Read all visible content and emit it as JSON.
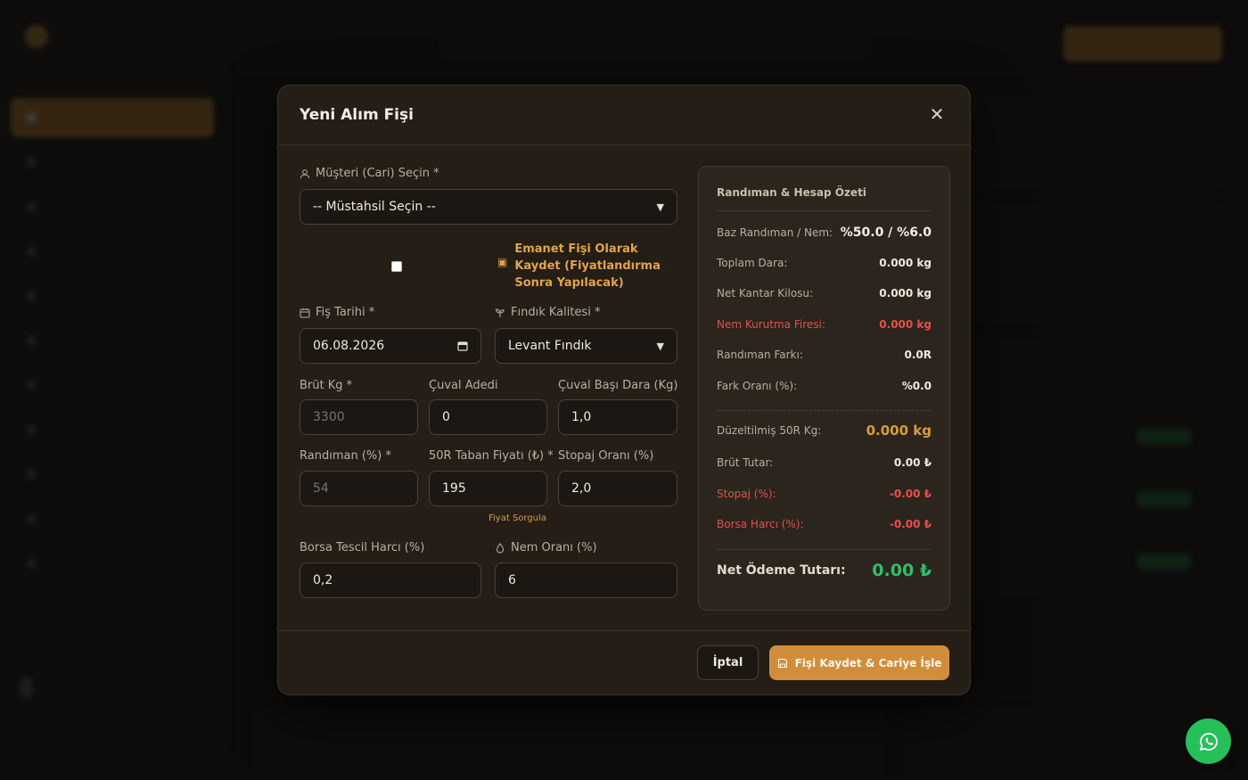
{
  "modal": {
    "title": "Yeni Alım Fişi",
    "close_label": "✕",
    "musteri": {
      "label": "Müşteri (Cari) Seçin *",
      "selected": "-- Müstahsil Seçin --"
    },
    "emanet": {
      "label": "Emanet Fişi Olarak Kaydet (Fiyatlandırma Sonra Yapılacak)",
      "checked": false
    },
    "fis_tarihi": {
      "label": "Fiş Tarihi *",
      "value": "06.08.2026"
    },
    "findik_kalitesi": {
      "label": "Fındık Kalitesi *",
      "selected": "Levant Fındık"
    },
    "brut_kg": {
      "label": "Brüt Kg *",
      "placeholder": "3300"
    },
    "cuval_adedi": {
      "label": "Çuval Adedi",
      "value": "0"
    },
    "cuval_basi_dara": {
      "label": "Çuval Başı Dara (Kg)",
      "value": "1,0"
    },
    "randiman": {
      "label": "Randıman (%) *",
      "placeholder": "54"
    },
    "taban_fiyati": {
      "label": "50R Taban Fiyatı (₺) *",
      "value": "195"
    },
    "stopaj_orani": {
      "label": "Stopaj Oranı (%)",
      "value": "2,0"
    },
    "fiyat_sorgula": "Fiyat Sorgula",
    "borsa_tescil": {
      "label": "Borsa Tescil Harcı (%)",
      "value": "0,2"
    },
    "nem_orani": {
      "label": "Nem Oranı (%)",
      "value": "6"
    },
    "summary": {
      "title": "Randıman & Hesap Özeti",
      "rows": [
        {
          "label": "Baz Randıman / Nem:",
          "value": "%50.0 / %6.0"
        },
        {
          "label": "Toplam Dara:",
          "value": "0.000 kg"
        },
        {
          "label": "Net Kantar Kilosu:",
          "value": "0.000 kg"
        },
        {
          "label": "Nem Kurutma Firesi:",
          "value": "0.000 kg"
        },
        {
          "label": "Randıman Farkı:",
          "value": "0.0R"
        },
        {
          "label": "Fark Oranı (%):",
          "value": "%0.0"
        },
        {
          "label": "Düzeltilmiş 50R Kg:",
          "value": "0.000 kg"
        },
        {
          "label": "Brüt Tutar:",
          "value": "0.00 ₺"
        },
        {
          "label": "Stopaj (%):",
          "value": "-0.00 ₺"
        },
        {
          "label": "Borsa Harcı (%):",
          "value": "-0.00 ₺"
        },
        {
          "label": "Net Ödeme Tutarı:",
          "value": "0.00 ₺"
        }
      ]
    },
    "footer": {
      "cancel_label": "İptal",
      "save_label": "Fişi Kaydet & Cariye İşle"
    }
  },
  "colors": {
    "accent": "#d08e3c",
    "danger": "#e0524a",
    "success": "#2fbf6a",
    "whatsapp": "#25c05a"
  },
  "icons": [
    "user-icon",
    "archive-icon",
    "calendar-icon",
    "sprout-icon",
    "droplet-icon",
    "save-icon",
    "close-icon",
    "whatsapp-icon"
  ]
}
